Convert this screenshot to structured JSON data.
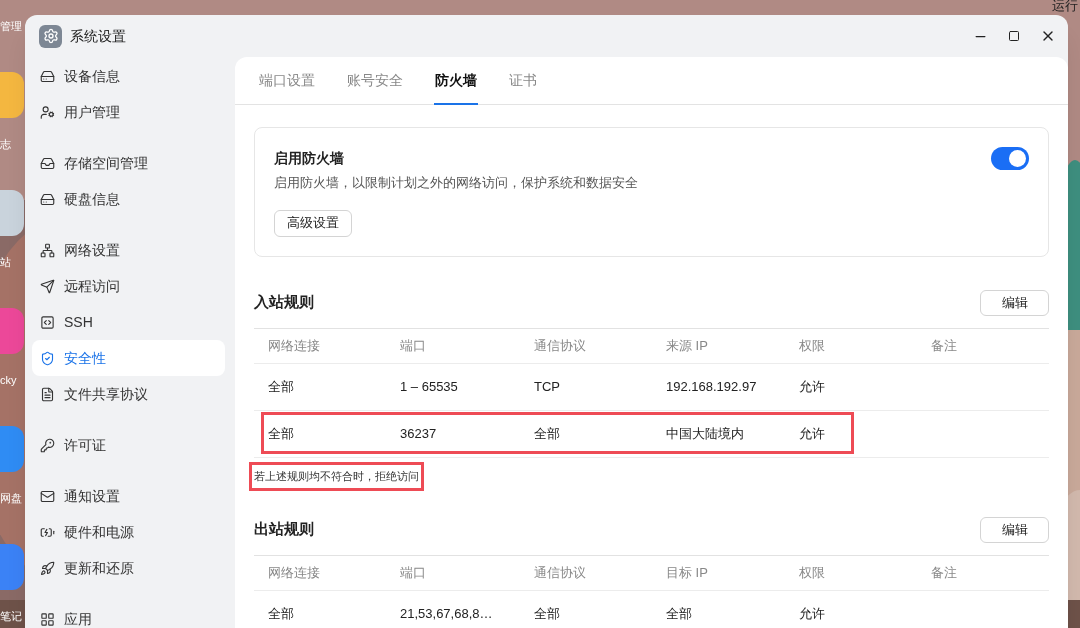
{
  "desktop": {
    "icon_labels": [
      {
        "label": "管理"
      },
      {
        "label": "志"
      },
      {
        "label": "站"
      },
      {
        "label": "cky"
      },
      {
        "label": "网盘"
      },
      {
        "label": "笔记"
      }
    ],
    "corner_label": "运行"
  },
  "window": {
    "title": "系统设置"
  },
  "sidebar": {
    "groups": [
      [
        {
          "label": "设备信息",
          "selected": false
        },
        {
          "label": "用户管理",
          "selected": false
        }
      ],
      [
        {
          "label": "存储空间管理",
          "selected": false
        },
        {
          "label": "硬盘信息",
          "selected": false
        }
      ],
      [
        {
          "label": "网络设置",
          "selected": false
        },
        {
          "label": "远程访问",
          "selected": false
        },
        {
          "label": "SSH",
          "selected": false
        },
        {
          "label": "安全性",
          "selected": true
        },
        {
          "label": "文件共享协议",
          "selected": false
        }
      ],
      [
        {
          "label": "许可证",
          "selected": false
        }
      ],
      [
        {
          "label": "通知设置",
          "selected": false
        },
        {
          "label": "硬件和电源",
          "selected": false
        },
        {
          "label": "更新和还原",
          "selected": false
        }
      ],
      [
        {
          "label": "应用",
          "selected": false
        }
      ]
    ]
  },
  "tabs": [
    {
      "label": "端口设置",
      "selected": false
    },
    {
      "label": "账号安全",
      "selected": false
    },
    {
      "label": "防火墙",
      "selected": true
    },
    {
      "label": "证书",
      "selected": false
    }
  ],
  "firewall": {
    "title": "启用防火墙",
    "description": "启用防火墙，以限制计划之外的网络访问，保护系统和数据安全",
    "on": true,
    "button": "高级设置"
  },
  "inbound": {
    "title": "入站规则",
    "edit": "编辑",
    "columns": [
      "网络连接",
      "端口",
      "通信协议",
      "来源 IP",
      "权限",
      "备注"
    ],
    "rows": [
      {
        "cells": [
          "全部",
          "1 – 65535",
          "TCP",
          "192.168.192.97",
          "允许"
        ],
        "highlighted": false
      },
      {
        "cells": [
          "全部",
          "36237",
          "全部",
          "中国大陆境内",
          "允许"
        ],
        "highlighted": true
      }
    ],
    "note": {
      "text": "若上述规则均不符合时，拒绝访问",
      "highlighted": true
    }
  },
  "outbound": {
    "title": "出站规则",
    "edit": "编辑",
    "columns": [
      "网络连接",
      "端口",
      "通信协议",
      "目标 IP",
      "权限",
      "备注"
    ],
    "rows": [
      {
        "cells": [
          "全部",
          "21,53,67,68,8…",
          "全部",
          "全部",
          "允许"
        ],
        "highlighted": false
      }
    ]
  }
}
